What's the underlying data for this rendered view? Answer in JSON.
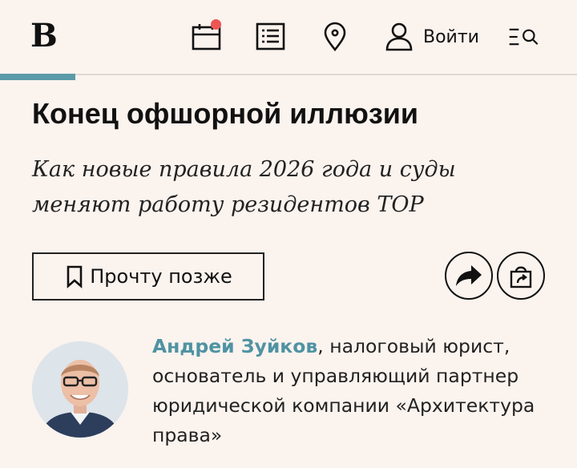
{
  "header": {
    "logo": "В",
    "login_label": "Войти",
    "icons": [
      "calendar-icon",
      "list-icon",
      "location-pin-icon",
      "user-icon",
      "menu-search-icon"
    ]
  },
  "reading_progress": 0.13,
  "article": {
    "title": "Конец офшорной иллюзии",
    "subtitle": "Как новые правила 2026 года и суды меняют работу резидентов ТОР"
  },
  "actions": {
    "read_later_label": "Прочту позже",
    "icons": [
      "share-icon",
      "gift-icon"
    ]
  },
  "author": {
    "name": "Андрей Зуйков",
    "description": ", налоговый юрист, основатель и управляющий партнер юридической компании «Архитектура права»"
  },
  "colors": {
    "background": "#fbf3ee",
    "accent": "#5b9aa8",
    "notification": "#ee5555"
  }
}
